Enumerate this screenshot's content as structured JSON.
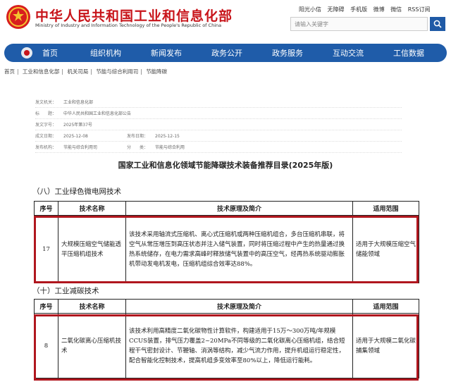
{
  "header": {
    "title": "中华人民共和国工业和信息化部",
    "subtitle": "Ministry of Industry and Information Technology of the People's Republic of China",
    "top_links": [
      "阳光小信",
      "无障碍",
      "手机版",
      "微博",
      "微信",
      "RSS订阅"
    ],
    "search_placeholder": "请输入关键字"
  },
  "nav": {
    "items": [
      "首页",
      "组织机构",
      "新闻发布",
      "政务公开",
      "政务服务",
      "互动交流",
      "工信数据"
    ]
  },
  "breadcrumb": [
    "首页",
    "工业和信息化部",
    "机关司局",
    "节能与综合利用司",
    "节能降碳"
  ],
  "meta": {
    "issuer_label": "发文机关：",
    "issuer": "工业和信息化部",
    "title_label": "标　　题：",
    "title": "中华人民共和国工业和信息化部公告",
    "doc_no_label": "发文字号：",
    "doc_no": "2025年第37号",
    "date_label": "成文日期：",
    "date": "2025-12-08",
    "publish_label": "发布日期：",
    "publish": "2025-12-15",
    "org_label": "发布机构：",
    "org": "节能与综合利用司",
    "cat_label": "分　　类：",
    "cat": "节能与综合利用"
  },
  "doc_title": "国家工业和信息化领域节能降碳技术装备推荐目录(2025年版)",
  "sections": [
    {
      "heading": "（八）工业绿色微电网技术",
      "headers": [
        "序号",
        "技术名称",
        "技术原理及简介",
        "适用范围"
      ],
      "row": {
        "no": "17",
        "name": "大规模压缩空气储能透平压缩机组技术",
        "desc": "该技术采用轴流式压缩机、离心式压缩机或两种压缩机组合，多台压缩机串联，将空气从常压增压到高压状态并注入储气装置，同时将压缩过程中产生的热量通过换热系统储存，在电力需求高峰时释放储气装置中的高压空气，经再热系统驱动膨胀机带动发电机发电，压缩机组综合效率达88%。",
        "scope": "适用于大规模压缩空气储能领域"
      }
    },
    {
      "heading": "（十）工业减碳技术",
      "headers": [
        "序号",
        "技术名称",
        "技术原理及简介",
        "适用范围"
      ],
      "row": {
        "no": "8",
        "name": "二氧化碳离心压缩机技术",
        "desc": "该技术利用高精度二氧化碳物性计算软件，构建适用于15万～300万吨/年规模CCUS装置，排气压力覆盖2~20MPa不同等级的二氧化碳离心压缩机组，结合短程干气密封设计、节鞭轴、消涡等结构，减少气流力作用，提升机组运行稳定性，配合智能化控制技术，提高机组多变效率至80%以上，降低运行能耗。",
        "scope": "适用于大规模二氧化碳捕集领域"
      }
    }
  ],
  "colors": {
    "brand_red": "#c8141a",
    "nav_blue": "#1f5ca9",
    "highlight_red": "#b0161e"
  }
}
